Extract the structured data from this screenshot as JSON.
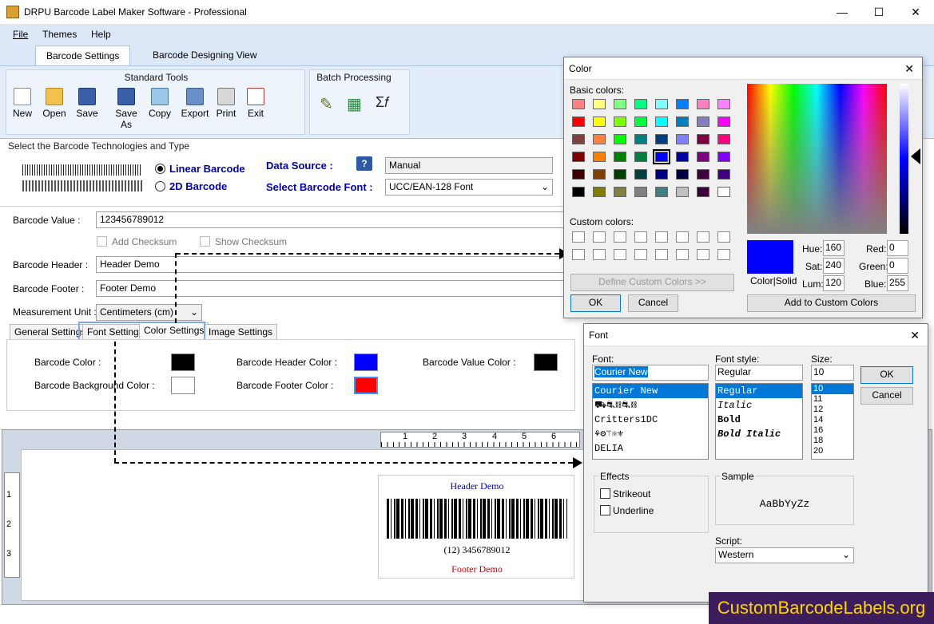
{
  "app": {
    "title": "DRPU Barcode Label Maker Software - Professional",
    "minimize": "—",
    "maximize": "☐",
    "close": "✕"
  },
  "menu": [
    "File",
    "Themes",
    "Help"
  ],
  "tabs": [
    "Barcode Settings",
    "Barcode Designing View"
  ],
  "standard_tools": {
    "title": "Standard Tools",
    "items": [
      "New",
      "Open",
      "Save",
      "Save As",
      "Copy",
      "Export",
      "Print",
      "Exit"
    ]
  },
  "batch": {
    "title": "Batch Processing",
    "items": [
      "✎",
      "▦",
      "Σ𝑓"
    ]
  },
  "tech": {
    "section": "Select the Barcode Technologies and Type",
    "linear": "Linear Barcode",
    "twod": "2D Barcode",
    "data_source_label": "Data Source :",
    "data_source_value": "Manual",
    "font_label": "Select Barcode Font :",
    "font_value": "UCC/EAN-128 Font",
    "help": "?"
  },
  "fields": {
    "value_label": "Barcode Value :",
    "value": "123456789012",
    "add_checksum": "Add Checksum",
    "show_checksum": "Show Checksum",
    "header_label": "Barcode Header :",
    "header": "Header Demo",
    "footer_label": "Barcode Footer :",
    "footer": "Footer Demo",
    "unit_label": "Measurement Unit :",
    "unit": "Centimeters (cm)"
  },
  "subtabs": [
    "General Settings",
    "Font Settings",
    "Color Settings",
    "Image Settings"
  ],
  "colors": {
    "barcode_color": "Barcode Color :",
    "background_color": "Barcode Background Color :",
    "header_color": "Barcode Header Color :",
    "footer_color": "Barcode Footer Color :",
    "value_color": "Barcode Value Color :",
    "c_barcode": "#000000",
    "c_bg": "#ffffff",
    "c_header": "#0000ff",
    "c_footer": "#ff0000",
    "c_value": "#000000"
  },
  "ruler_h": [
    "1",
    "2",
    "3",
    "4",
    "5",
    "6"
  ],
  "ruler_v": [
    "1",
    "2",
    "3"
  ],
  "preview": {
    "header": "Header Demo",
    "value": "(12) 3456789012",
    "footer": "Footer Demo"
  },
  "color_dialog": {
    "title": "Color",
    "close": "✕",
    "basic": "Basic colors:",
    "custom": "Custom colors:",
    "define": "Define Custom Colors >>",
    "ok": "OK",
    "cancel": "Cancel",
    "add": "Add to Custom Colors",
    "color_solid": "Color|Solid",
    "hue_label": "Hue:",
    "hue": "160",
    "sat_label": "Sat:",
    "sat": "240",
    "lum_label": "Lum:",
    "lum": "120",
    "red_label": "Red:",
    "red": "0",
    "green_label": "Green:",
    "green": "0",
    "blue_label": "Blue:",
    "blue": "255",
    "basic_colors": [
      "#ff8080",
      "#ffff80",
      "#80ff80",
      "#00ff80",
      "#80ffff",
      "#0080ff",
      "#ff80c0",
      "#ff80ff",
      "#ff0000",
      "#ffff00",
      "#80ff00",
      "#00ff40",
      "#00ffff",
      "#0080c0",
      "#8080c0",
      "#ff00ff",
      "#804040",
      "#ff8040",
      "#00ff00",
      "#008080",
      "#004080",
      "#8080ff",
      "#800040",
      "#ff0080",
      "#800000",
      "#ff8000",
      "#008000",
      "#008040",
      "#0000ff",
      "#0000a0",
      "#800080",
      "#8000ff",
      "#400000",
      "#804000",
      "#004000",
      "#004040",
      "#000080",
      "#000040",
      "#400040",
      "#400080",
      "#000000",
      "#808000",
      "#808040",
      "#808080",
      "#408080",
      "#c0c0c0",
      "#400040",
      "#ffffff"
    ]
  },
  "font_dialog": {
    "title": "Font",
    "close": "✕",
    "font_label": "Font:",
    "font_value": "Courier New",
    "style_label": "Font style:",
    "style_value": "Regular",
    "size_label": "Size:",
    "size_value": "10",
    "ok": "OK",
    "cancel": "Cancel",
    "fonts": [
      "Courier New",
      "⛟⛐⛓⛐⛓",
      "Critters1DC",
      "⚘⚙⚚⚛⚜",
      "DELIA"
    ],
    "styles": [
      "Regular",
      "Italic",
      "Bold",
      "Bold Italic"
    ],
    "sizes": [
      "10",
      "11",
      "12",
      "14",
      "16",
      "18",
      "20"
    ],
    "effects": "Effects",
    "strikeout": "Strikeout",
    "underline": "Underline",
    "sample_label": "Sample",
    "sample": "AaBbYyZz",
    "script_label": "Script:",
    "script": "Western"
  },
  "watermark": "CustomBarcodeLabels.org"
}
